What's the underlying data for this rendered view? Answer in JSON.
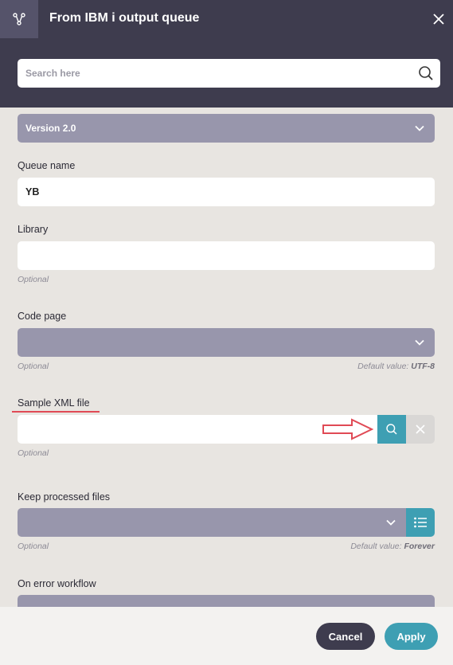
{
  "header": {
    "title": "From IBM i output queue",
    "icon": "connector-icon",
    "close_icon": "close-icon"
  },
  "search": {
    "placeholder": "Search here",
    "value": ""
  },
  "version_select": {
    "label": "Version 2.0"
  },
  "fields": {
    "queue_name": {
      "label": "Queue name",
      "value": "YB"
    },
    "library": {
      "label": "Library",
      "value": "",
      "hint": "Optional"
    },
    "code_page": {
      "label": "Code page",
      "value": "",
      "hint": "Optional",
      "default_prefix": "Default value: ",
      "default_value": "UTF-8"
    },
    "sample_xml": {
      "label": "Sample XML file",
      "value": "",
      "hint": "Optional"
    },
    "keep_processed": {
      "label": "Keep processed files",
      "value": "",
      "hint": "Optional",
      "default_prefix": "Default value: ",
      "default_value": "Forever"
    },
    "on_error_workflow": {
      "label": "On error workflow"
    }
  },
  "footer": {
    "cancel_label": "Cancel",
    "apply_label": "Apply"
  },
  "colors": {
    "header_bg": "#3e3c4e",
    "content_bg": "#e8e5e1",
    "select_bg": "#9896ac",
    "accent_teal": "#3e9fb3",
    "annotation_red": "#e04a55"
  }
}
